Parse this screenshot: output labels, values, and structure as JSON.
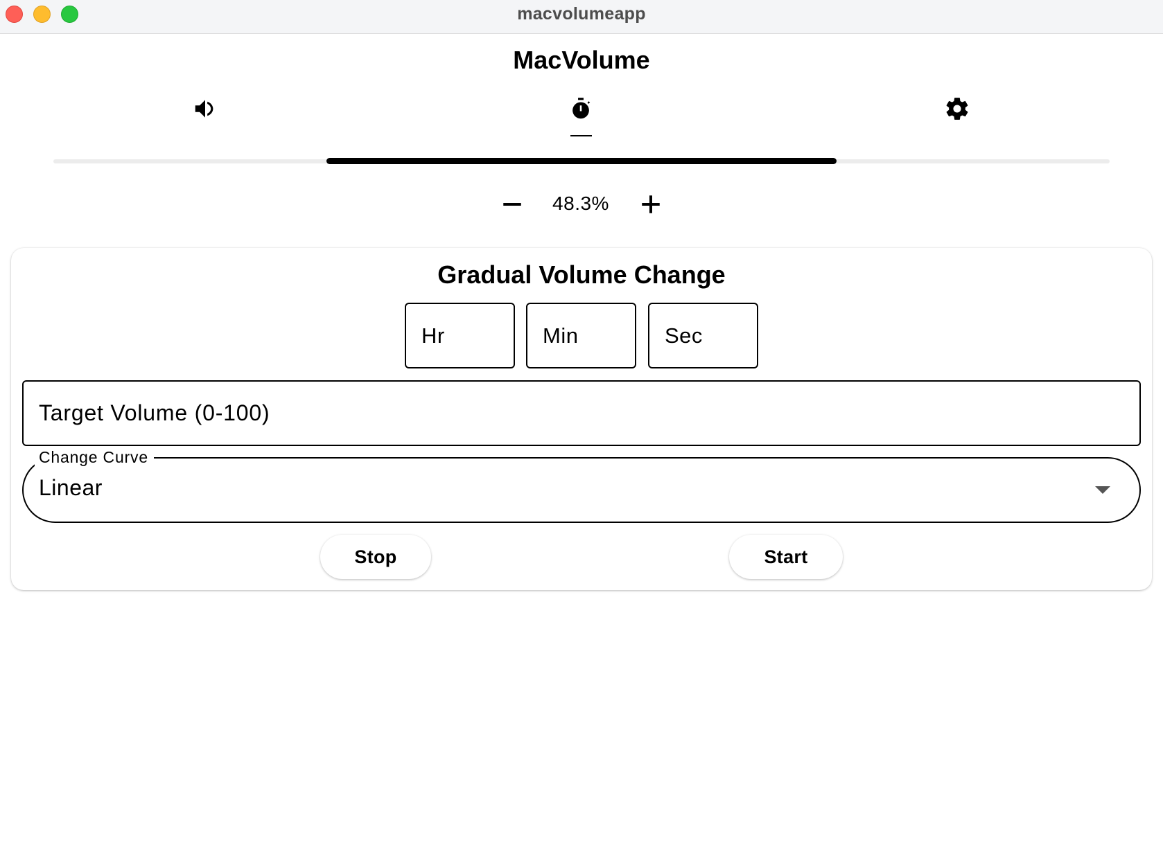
{
  "window": {
    "title": "macvolumeapp",
    "controls": [
      "close",
      "minimize",
      "zoom"
    ]
  },
  "app": {
    "title": "MacVolume"
  },
  "tabs": [
    {
      "name": "volume",
      "icon": "speaker-icon",
      "active": false
    },
    {
      "name": "timer",
      "icon": "timer-icon",
      "active": true
    },
    {
      "name": "settings",
      "icon": "gear-icon",
      "active": false
    }
  ],
  "volume": {
    "value_percent": 48.3,
    "display": "48.3%",
    "decrease_icon": "minus-icon",
    "increase_icon": "plus-icon"
  },
  "gradual_change": {
    "title": "Gradual Volume Change",
    "hours_placeholder": "Hr",
    "minutes_placeholder": "Min",
    "seconds_placeholder": "Sec",
    "target_placeholder": "Target Volume (0-100)",
    "curve_label": "Change Curve",
    "curve_value": "Linear",
    "stop_label": "Stop",
    "start_label": "Start"
  },
  "colors": {
    "accent": "#000000",
    "track": "#ececec",
    "titlebar": "#f4f5f7",
    "close": "#fe5f57",
    "minimize": "#febc2e",
    "zoom": "#28c840"
  }
}
